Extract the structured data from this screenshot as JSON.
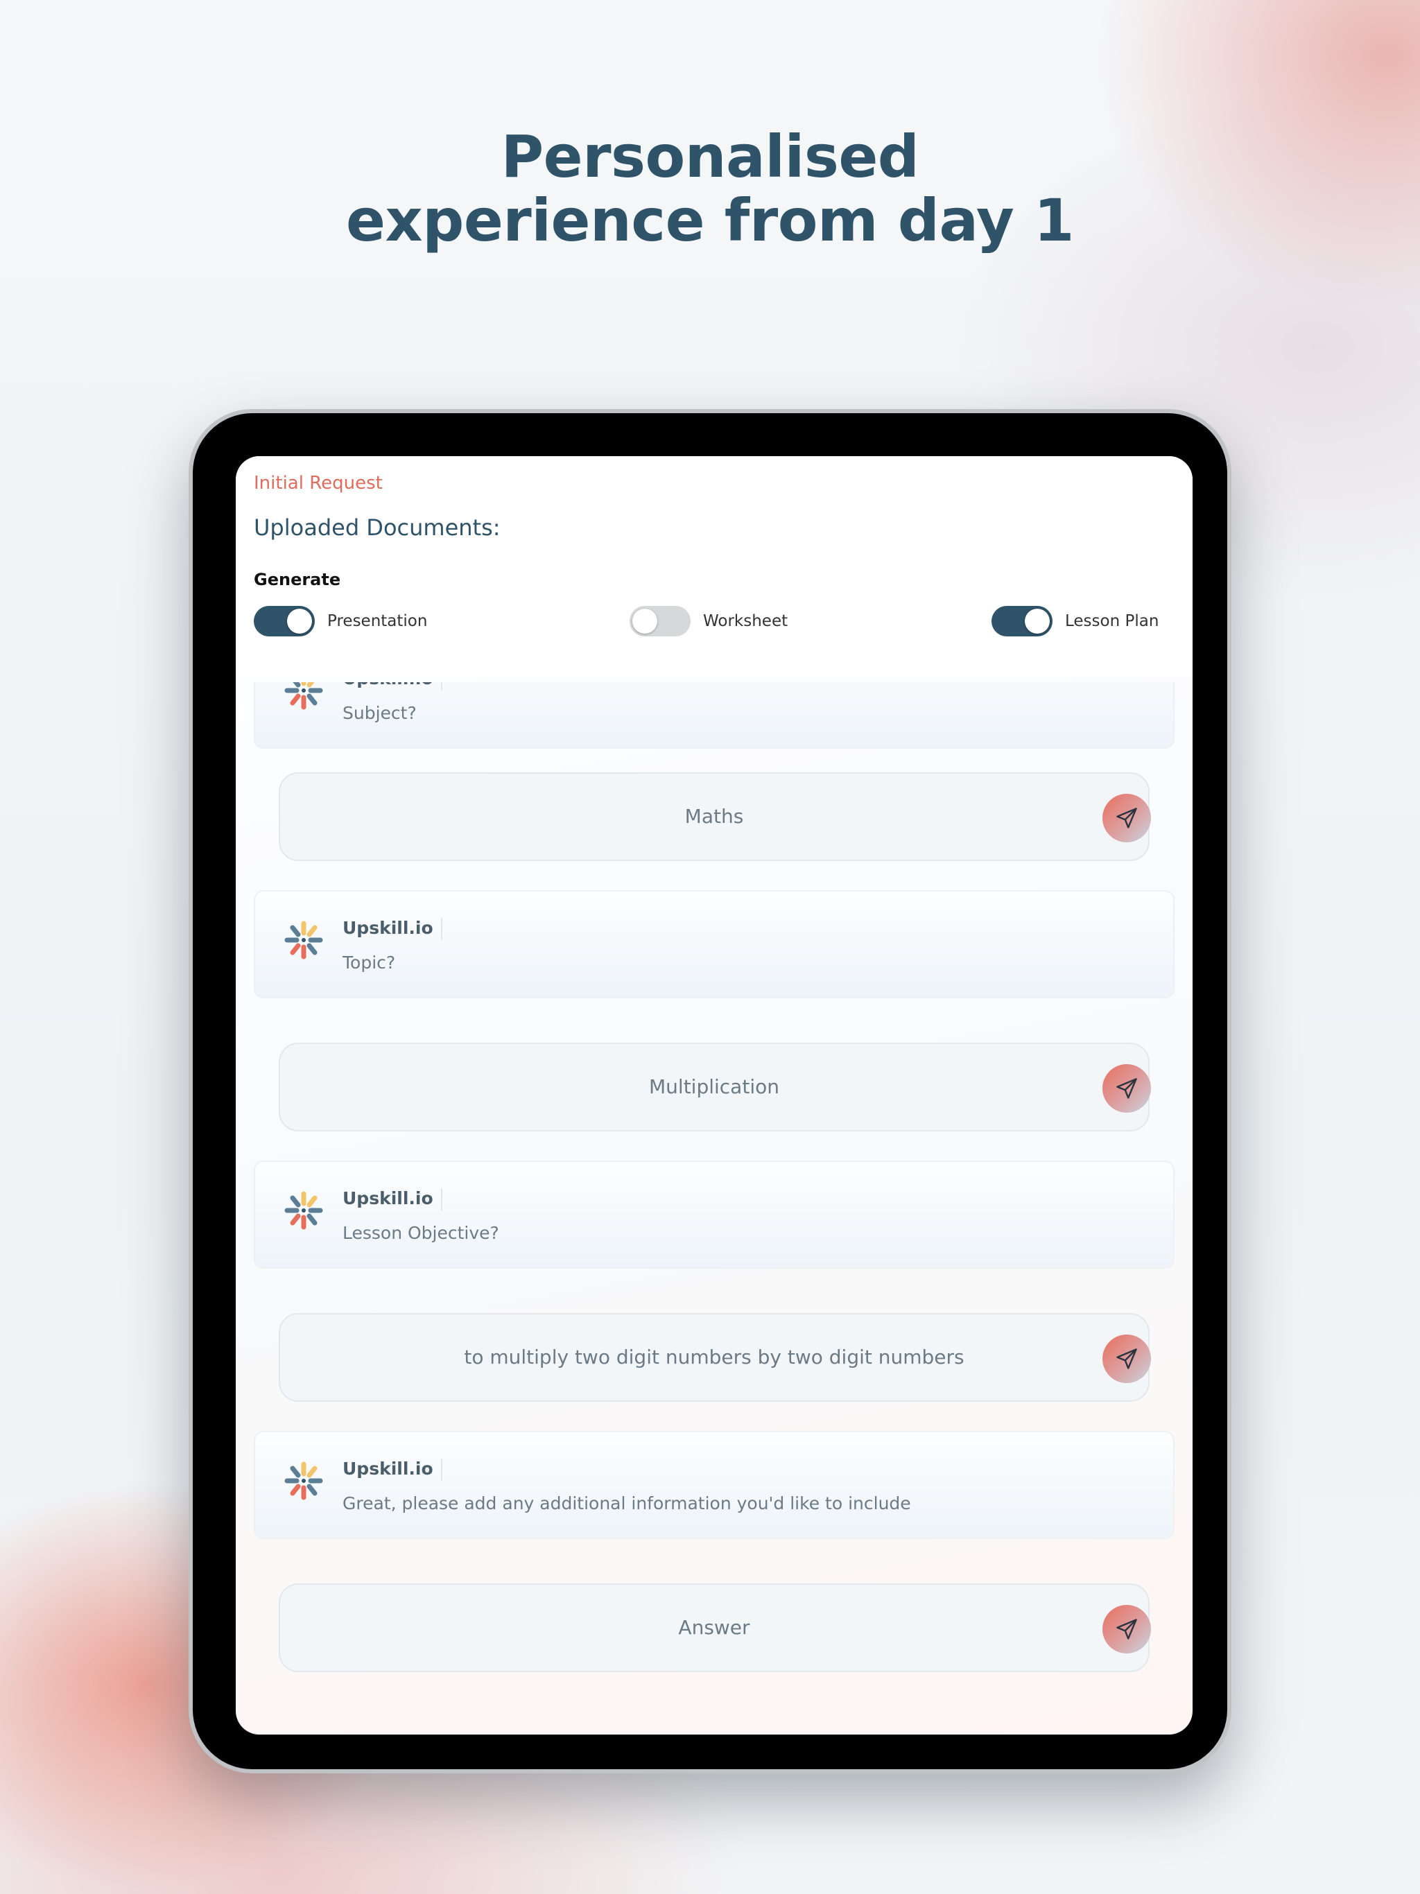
{
  "headline": {
    "line1": "Personalised",
    "line2": "experience from day 1"
  },
  "screen": {
    "initial_request": "Initial Request",
    "uploaded_documents": "Uploaded Documents:",
    "generate_label": "Generate",
    "toggles": [
      {
        "label": "Presentation",
        "on": true
      },
      {
        "label": "Worksheet",
        "on": false
      },
      {
        "label": "Lesson Plan",
        "on": true
      }
    ]
  },
  "chat": {
    "bot_name": "Upskill.io",
    "messages": [
      {
        "bot": "Subject?",
        "answer": "Maths"
      },
      {
        "bot": "Topic?",
        "answer": "Multiplication"
      },
      {
        "bot": "Lesson Objective?",
        "answer": "to multiply two digit numbers by two digit numbers"
      },
      {
        "bot": "Great, please add any additional information you'd like to include",
        "answer": "Answer"
      }
    ]
  },
  "colors": {
    "primary": "#2f5369",
    "accent": "#e06d5c",
    "toggle_off": "#d6d8da"
  },
  "icons": {
    "send": "paper-plane-icon",
    "logo": "upskill-logo-icon"
  }
}
